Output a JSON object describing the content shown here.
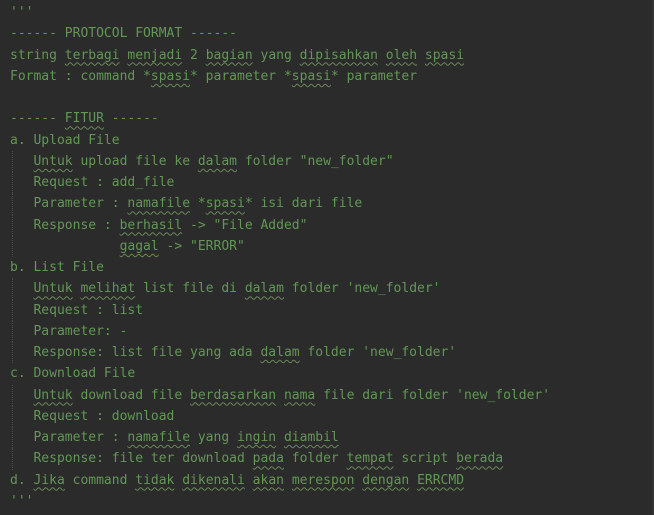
{
  "editor": {
    "colors": {
      "background": "#2b2b2b",
      "docstring": "#629755",
      "typo_underline": "#6a8759",
      "indent_guide": "#4a4a4a"
    },
    "lines": [
      {
        "indent": 0,
        "segments": [
          {
            "text": "'''"
          }
        ]
      },
      {
        "indent": 0,
        "segments": [
          {
            "text": "------ PROTOCOL FORMAT ------"
          }
        ]
      },
      {
        "indent": 0,
        "segments": [
          {
            "text": "string "
          },
          {
            "text": "terbagi",
            "typo": true
          },
          {
            "text": " "
          },
          {
            "text": "menjadi",
            "typo": true
          },
          {
            "text": " 2 "
          },
          {
            "text": "bagian",
            "typo": true
          },
          {
            "text": " yang "
          },
          {
            "text": "dipisahkan",
            "typo": true
          },
          {
            "text": " "
          },
          {
            "text": "oleh",
            "typo": true
          },
          {
            "text": " "
          },
          {
            "text": "spasi",
            "typo": true
          }
        ]
      },
      {
        "indent": 0,
        "segments": [
          {
            "text": "Format : command *"
          },
          {
            "text": "spasi",
            "typo": true
          },
          {
            "text": "* parameter *"
          },
          {
            "text": "spasi",
            "typo": true
          },
          {
            "text": "* parameter"
          }
        ]
      },
      {
        "indent": 0,
        "segments": [
          {
            "text": ""
          }
        ]
      },
      {
        "indent": 0,
        "segments": [
          {
            "text": "------ "
          },
          {
            "text": "FITUR",
            "typo": true
          },
          {
            "text": " ------"
          }
        ]
      },
      {
        "indent": 0,
        "segments": [
          {
            "text": "a. Upload File"
          }
        ]
      },
      {
        "indent": 3,
        "segments": [
          {
            "text": "Untuk",
            "typo": true
          },
          {
            "text": " upload file ke "
          },
          {
            "text": "dalam",
            "typo": true
          },
          {
            "text": " folder \"new_folder\""
          }
        ]
      },
      {
        "indent": 3,
        "segments": [
          {
            "text": "Request : add_file"
          }
        ]
      },
      {
        "indent": 3,
        "segments": [
          {
            "text": "Parameter : "
          },
          {
            "text": "namafile",
            "typo": true
          },
          {
            "text": " *"
          },
          {
            "text": "spasi",
            "typo": true
          },
          {
            "text": "* isi dari file"
          }
        ]
      },
      {
        "indent": 3,
        "segments": [
          {
            "text": "Response : "
          },
          {
            "text": "berhasil",
            "typo": true
          },
          {
            "text": " -> \"File Added\""
          }
        ]
      },
      {
        "indent": 14,
        "segments": [
          {
            "text": "gagal",
            "typo": true
          },
          {
            "text": " -> \"ERROR\""
          }
        ]
      },
      {
        "indent": 0,
        "segments": [
          {
            "text": "b. List File"
          }
        ]
      },
      {
        "indent": 3,
        "segments": [
          {
            "text": "Untuk",
            "typo": true
          },
          {
            "text": " "
          },
          {
            "text": "melihat",
            "typo": true
          },
          {
            "text": " list file di "
          },
          {
            "text": "dalam",
            "typo": true
          },
          {
            "text": " folder 'new_folder'"
          }
        ]
      },
      {
        "indent": 3,
        "segments": [
          {
            "text": "Request : list"
          }
        ]
      },
      {
        "indent": 3,
        "segments": [
          {
            "text": "Parameter: -"
          }
        ]
      },
      {
        "indent": 3,
        "segments": [
          {
            "text": "Response: list file yang ada "
          },
          {
            "text": "dalam",
            "typo": true
          },
          {
            "text": " folder 'new_folder'"
          }
        ]
      },
      {
        "indent": 0,
        "segments": [
          {
            "text": "c. Download File"
          }
        ]
      },
      {
        "indent": 3,
        "segments": [
          {
            "text": "Untuk",
            "typo": true
          },
          {
            "text": " download file "
          },
          {
            "text": "berdasarkan",
            "typo": true
          },
          {
            "text": " "
          },
          {
            "text": "nama",
            "typo": true
          },
          {
            "text": " file dari folder 'new_folder'"
          }
        ]
      },
      {
        "indent": 3,
        "segments": [
          {
            "text": "Request : download"
          }
        ]
      },
      {
        "indent": 3,
        "segments": [
          {
            "text": "Parameter : "
          },
          {
            "text": "namafile",
            "typo": true
          },
          {
            "text": " yang "
          },
          {
            "text": "ingin",
            "typo": true
          },
          {
            "text": " "
          },
          {
            "text": "diambil",
            "typo": true
          }
        ]
      },
      {
        "indent": 3,
        "segments": [
          {
            "text": "Response: file ter download "
          },
          {
            "text": "pada",
            "typo": true
          },
          {
            "text": " folder "
          },
          {
            "text": "tempat",
            "typo": true
          },
          {
            "text": " script "
          },
          {
            "text": "berada",
            "typo": true
          }
        ]
      },
      {
        "indent": 0,
        "segments": [
          {
            "text": "d. "
          },
          {
            "text": "Jika",
            "typo": true
          },
          {
            "text": " command "
          },
          {
            "text": "tidak",
            "typo": true
          },
          {
            "text": " "
          },
          {
            "text": "dikenali",
            "typo": true
          },
          {
            "text": " "
          },
          {
            "text": "akan",
            "typo": true
          },
          {
            "text": " "
          },
          {
            "text": "merespon",
            "typo": true
          },
          {
            "text": " "
          },
          {
            "text": "dengan",
            "typo": true
          },
          {
            "text": " "
          },
          {
            "text": "ERRCMD",
            "typo": true
          }
        ]
      },
      {
        "indent": 0,
        "segments": [
          {
            "text": "'''"
          }
        ]
      }
    ]
  }
}
